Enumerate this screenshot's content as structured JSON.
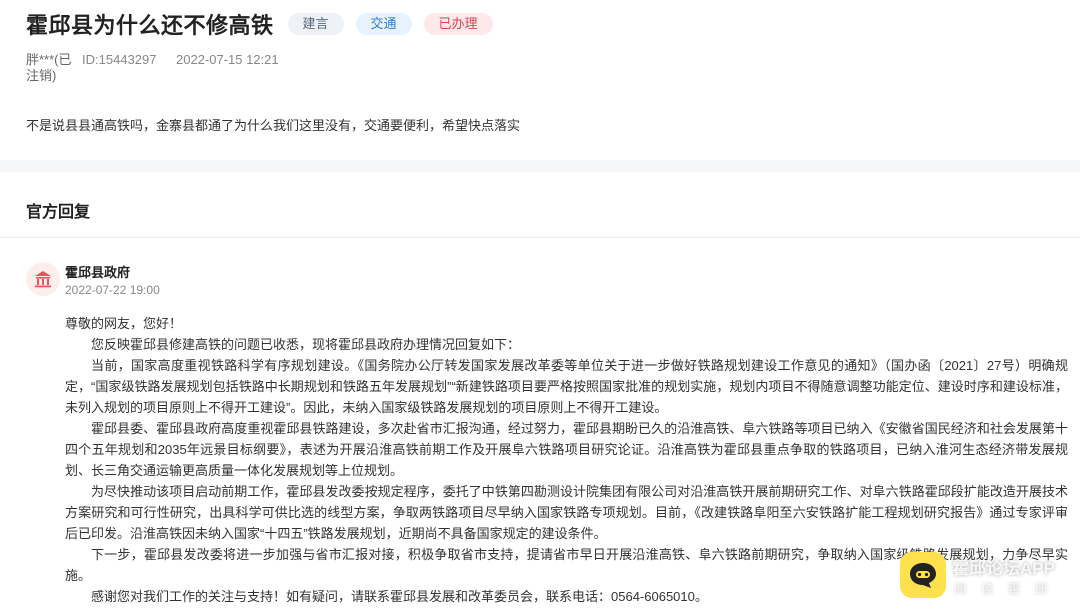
{
  "question": {
    "title": "霍邱县为什么还不修高铁",
    "tags": [
      "建言",
      "交通",
      "已办理"
    ],
    "author": "胖***(已注销)",
    "id_label": "ID:15443297",
    "time": "2022-07-15 12:21",
    "content": "不是说县县通高铁吗，金寨县都通了为什么我们这里没有，交通要便利，希望快点落实"
  },
  "reply_section": {
    "title": "官方回复"
  },
  "reply": {
    "org": "霍邱县政府",
    "time": "2022-07-22 19:00",
    "greeting": "尊敬的网友，您好！",
    "paragraphs": [
      "您反映霍邱县修建高铁的问题已收悉，现将霍邱县政府办理情况回复如下：",
      "当前，国家高度重视铁路科学有序规划建设。《国务院办公厅转发国家发展改革委等单位关于进一步做好铁路规划建设工作意见的通知》（国办函〔2021〕27号）明确规定，“国家级铁路发展规划包括铁路中长期规划和铁路五年发展规划”“新建铁路项目要严格按照国家批准的规划实施，规划内项目不得随意调整功能定位、建设时序和建设标准，未列入规划的项目原则上不得开工建设”。因此，未纳入国家级铁路发展规划的项目原则上不得开工建设。",
      "霍邱县委、霍邱县政府高度重视霍邱县铁路建设，多次赴省市汇报沟通，经过努力，霍邱县期盼已久的沿淮高铁、阜六铁路等项目已纳入《安徽省国民经济和社会发展第十四个五年规划和2035年远景目标纲要》，表述为开展沿淮高铁前期工作及开展阜六铁路项目研究论证。沿淮高铁为霍邱县重点争取的铁路项目，已纳入淮河生态经济带发展规划、长三角交通运输更高质量一体化发展规划等上位规划。",
      "为尽快推动该项目启动前期工作，霍邱县发改委按规定程序，委托了中铁第四勘测设计院集团有限公司对沿淮高铁开展前期研究工作、对阜六铁路霍邱段扩能改造开展技术方案研究和可行性研究，出具科学可供比选的线型方案，争取两铁路项目尽早纳入国家铁路专项规划。目前，《改建铁路阜阳至六安铁路扩能工程规划研究报告》通过专家评审后已印发。沿淮高铁因未纳入国家“十四五”铁路发展规划，近期尚不具备国家规定的建设条件。",
      "下一步，霍邱县发改委将进一步加强与省市汇报对接，积极争取省市支持，提请省市早日开展沿淮高铁、阜六铁路前期研究，争取纳入国家级铁路发展规划，力争尽早实施。",
      "感谢您对我们工作的关注与支持！如有疑问，请联系霍邱县发展和改革委员会，联系电话：0564-6065010。"
    ]
  },
  "watermark": {
    "title": "霍邱论坛APP",
    "subtitle": "阅读霍邱"
  },
  "colors": {
    "tag_suggest_bg": "#eef1f5",
    "tag_traffic_text": "#2f7fd8",
    "tag_done_text": "#e0414f",
    "avatar_icon": "#e8555e",
    "watermark_logo": "#ffe14d"
  },
  "icons": {
    "avatar": "government-building-icon",
    "watermark": "chat-bubble-logo-icon"
  }
}
